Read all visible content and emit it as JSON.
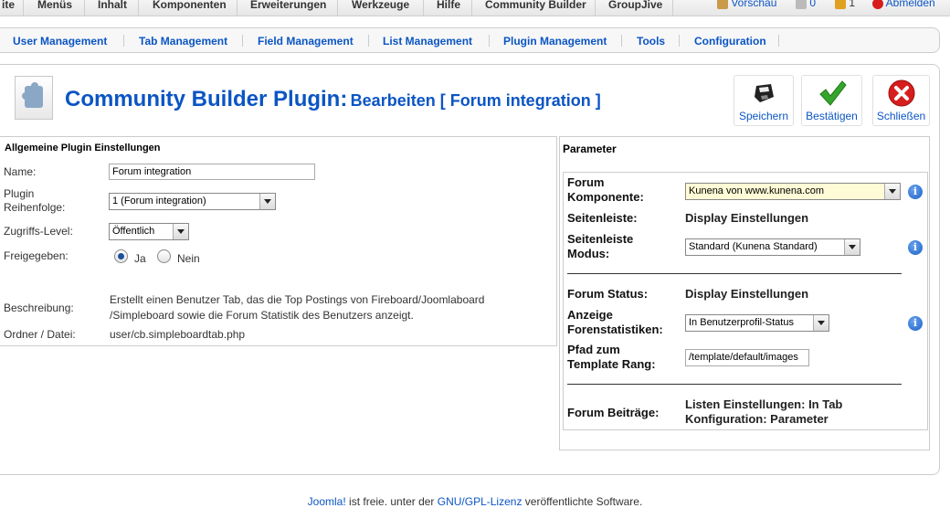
{
  "topmenu": {
    "items": [
      "ite",
      "Menüs",
      "Inhalt",
      "Komponenten",
      "Erweiterungen",
      "Werkzeuge",
      "Hilfe",
      "Community Builder",
      "GroupJive"
    ],
    "preview": "Vorschau",
    "messages_count": "0",
    "users_count": "1",
    "logout": "Abmelden"
  },
  "submenu": {
    "items": [
      "User Management",
      "Tab Management",
      "Field Management",
      "List Management",
      "Plugin Management",
      "Tools",
      "Configuration"
    ]
  },
  "header": {
    "title": "Community Builder Plugin:",
    "subtitle": "Bearbeiten [ Forum integration ]"
  },
  "toolbar": {
    "save": "Speichern",
    "apply": "Bestätigen",
    "close": "Schließen"
  },
  "general": {
    "legend": "Allgemeine Plugin Einstellungen",
    "name_label": "Name:",
    "name_value": "Forum integration",
    "order_label_1": "Plugin",
    "order_label_2": "Reihenfolge:",
    "order_value": "1 (Forum integration)",
    "access_label": "Zugriffs-Level:",
    "access_value": "Öffentlich",
    "published_label": "Freigegeben:",
    "published_yes": "Ja",
    "published_no": "Nein",
    "description_label": "Beschreibung:",
    "description_1": "Erstellt einen Benutzer Tab, das die Top Postings von Fireboard/Joomlaboard",
    "description_2": "/Simpleboard sowie die Forum Statistik des Benutzers anzeigt.",
    "folder_label": "Ordner / Datei:",
    "folder_value": "user/cb.simpleboardtab.php"
  },
  "params": {
    "legend": "Parameter",
    "forum_component_label_1": "Forum",
    "forum_component_label_2": "Komponente:",
    "forum_component_value": "Kunena von www.kunena.com",
    "sidebar_label": "Seitenleiste:",
    "sidebar_value": "Display Einstellungen",
    "sidebar_mode_label_1": "Seitenleiste",
    "sidebar_mode_label_2": "Modus:",
    "sidebar_mode_value": "Standard (Kunena Standard)",
    "forum_status_label": "Forum Status:",
    "forum_status_value": "Display Einstellungen",
    "show_stats_label_1": "Anzeige",
    "show_stats_label_2": "Forenstatistiken:",
    "show_stats_value": "In Benutzerprofil-Status",
    "template_path_label_1": "Pfad zum",
    "template_path_label_2": "Template Rang:",
    "template_path_value": "/template/default/images",
    "forum_posts_label": "Forum Beiträge:",
    "forum_posts_value_1": "Listen Einstellungen: In Tab",
    "forum_posts_value_2": "Konfiguration: Parameter",
    "info_glyph": "i"
  },
  "footer": {
    "joomla": "Joomla!",
    "text_1": " ist freie. unter der ",
    "license": "GNU/GPL-Lizenz",
    "text_2": " veröffentlichte Software."
  },
  "colors": {
    "link": "#0b55c4",
    "save_green": "#35a52b",
    "close_red": "#d71d1d"
  }
}
